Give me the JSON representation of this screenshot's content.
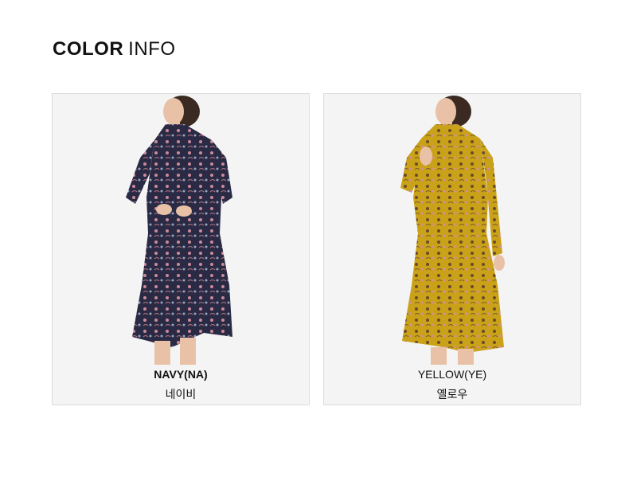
{
  "heading": {
    "bold": "COLOR",
    "light": "INFO"
  },
  "colors": [
    {
      "name_en": "NAVY(NA)",
      "name_ko": "네이비",
      "swatch": "#2b2a44",
      "print": "#c98a9a"
    },
    {
      "name_en": "YELLOW(YE)",
      "name_ko": "옐로우",
      "swatch": "#c9a21a",
      "print": "#6b4a2a"
    }
  ]
}
